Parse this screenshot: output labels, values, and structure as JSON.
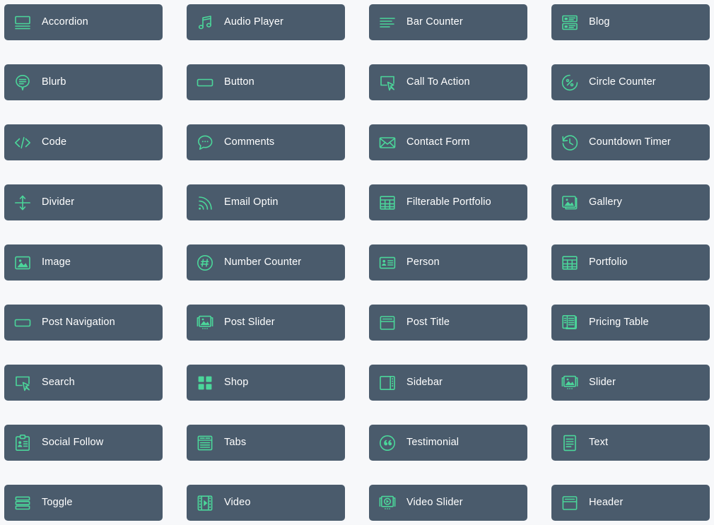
{
  "theme": {
    "page_background": "#f7f8fa",
    "card_background": "#4a5b6c",
    "icon_color": "#4bd69a",
    "label_color": "#ffffff"
  },
  "modules": [
    {
      "label": "Accordion",
      "icon": "accordion-icon"
    },
    {
      "label": "Audio Player",
      "icon": "music-note-icon"
    },
    {
      "label": "Bar Counter",
      "icon": "bar-counter-icon"
    },
    {
      "label": "Blog",
      "icon": "blog-list-icon"
    },
    {
      "label": "Blurb",
      "icon": "speech-pin-icon"
    },
    {
      "label": "Button",
      "icon": "button-rectangle-icon"
    },
    {
      "label": "Call To Action",
      "icon": "cursor-click-icon"
    },
    {
      "label": "Circle Counter",
      "icon": "circle-percent-icon"
    },
    {
      "label": "Code",
      "icon": "code-brackets-icon"
    },
    {
      "label": "Comments",
      "icon": "comment-bubble-icon"
    },
    {
      "label": "Contact Form",
      "icon": "envelope-icon"
    },
    {
      "label": "Countdown Timer",
      "icon": "clock-rewind-icon"
    },
    {
      "label": "Divider",
      "icon": "divider-arrows-icon"
    },
    {
      "label": "Email Optin",
      "icon": "rss-signal-icon"
    },
    {
      "label": "Filterable Portfolio",
      "icon": "grid-table-icon"
    },
    {
      "label": "Gallery",
      "icon": "gallery-stack-icon"
    },
    {
      "label": "Image",
      "icon": "image-icon"
    },
    {
      "label": "Number Counter",
      "icon": "hash-circle-icon"
    },
    {
      "label": "Person",
      "icon": "id-card-icon"
    },
    {
      "label": "Portfolio",
      "icon": "grid-table-icon"
    },
    {
      "label": "Post Navigation",
      "icon": "button-rectangle-icon"
    },
    {
      "label": "Post Slider",
      "icon": "image-slider-icon"
    },
    {
      "label": "Post Title",
      "icon": "window-header-icon"
    },
    {
      "label": "Pricing Table",
      "icon": "pricing-columns-icon"
    },
    {
      "label": "Search",
      "icon": "cursor-click-icon"
    },
    {
      "label": "Shop",
      "icon": "four-squares-icon"
    },
    {
      "label": "Sidebar",
      "icon": "sidebar-icon"
    },
    {
      "label": "Slider",
      "icon": "image-slider-icon"
    },
    {
      "label": "Social Follow",
      "icon": "badge-id-icon"
    },
    {
      "label": "Tabs",
      "icon": "tabs-document-icon"
    },
    {
      "label": "Testimonial",
      "icon": "quote-circle-icon"
    },
    {
      "label": "Text",
      "icon": "text-document-icon"
    },
    {
      "label": "Toggle",
      "icon": "toggle-bars-icon"
    },
    {
      "label": "Video",
      "icon": "film-play-icon"
    },
    {
      "label": "Video Slider",
      "icon": "video-slider-icon"
    },
    {
      "label": "Header",
      "icon": "window-header-icon"
    }
  ]
}
